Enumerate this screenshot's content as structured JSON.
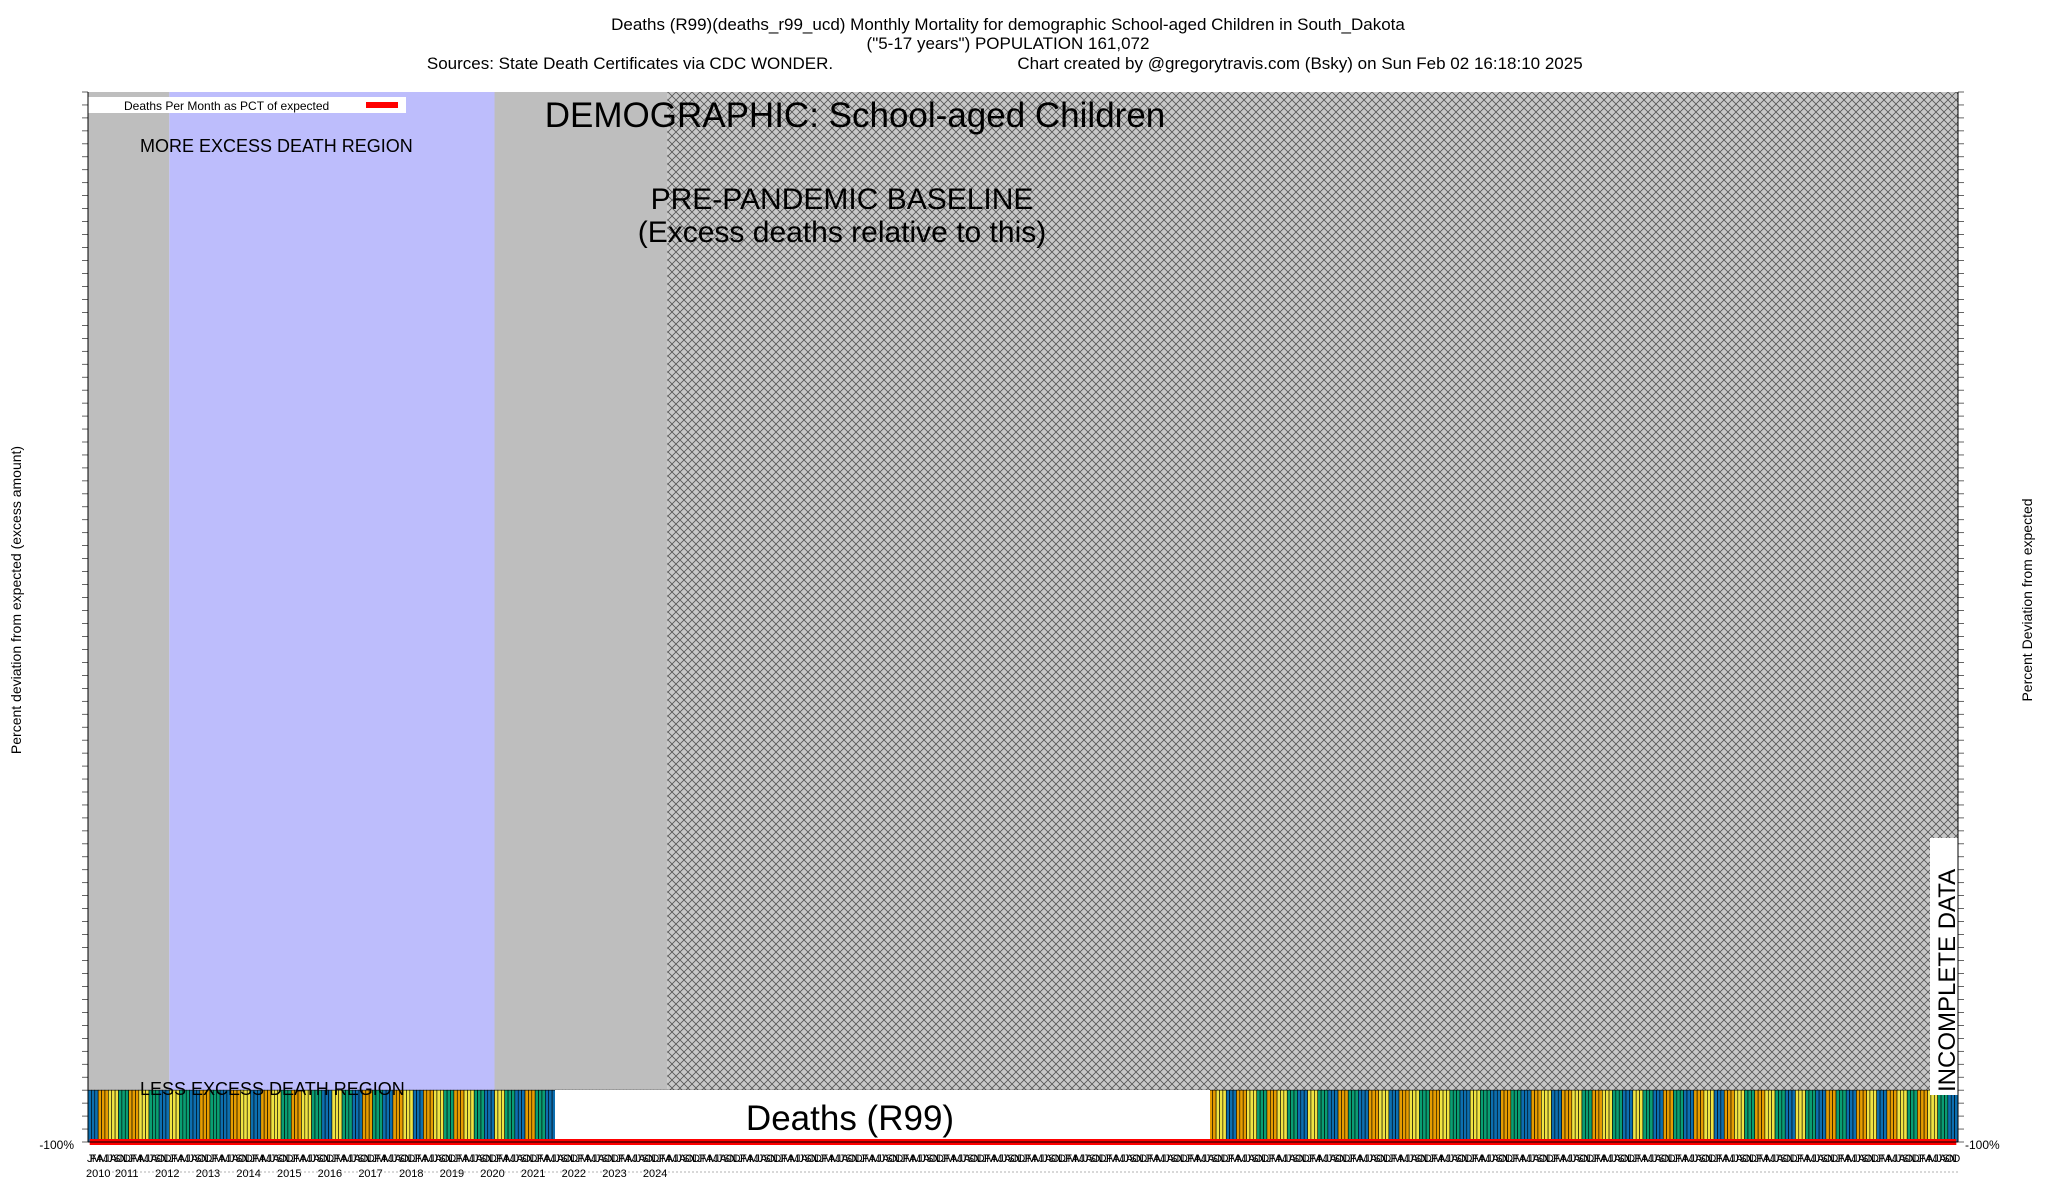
{
  "header": {
    "line1": "Deaths (R99)(deaths_r99_ucd) Monthly Mortality for demographic School-aged Children in South_Dakota",
    "line2": "(\"5-17 years\") POPULATION 161,072",
    "line3_left": "Sources: State Death Certificates via CDC WONDER.",
    "line3_right": "Chart created by @gregorytravis.com (Bsky) on Sun Feb 02 16:18:10 2025"
  },
  "legend": {
    "label": "Deaths Per Month as PCT of expected"
  },
  "annotations": {
    "demographic": "DEMOGRAPHIC: School-aged Children",
    "baseline_line1": "PRE-PANDEMIC BASELINE",
    "baseline_line2": "(Excess deaths relative to this)",
    "more_excess": "MORE EXCESS DEATH REGION",
    "less_excess": "LESS EXCESS DEATH REGION",
    "series_box": "Deaths (R99)",
    "incomplete": "INCOMPLETE DATA"
  },
  "axes": {
    "ylabel_left": "Percent deviation from expected (excess amount)",
    "ylabel_right": "Percent Deviation from expected",
    "bottom_tick": "-100%"
  },
  "colors": {
    "line": "#ff0000",
    "baseline_region": "#bdbdfc",
    "excess_region": "#bebebe",
    "bar_blue": "#0d6fb0",
    "bar_orange": "#e59c00",
    "bar_yellow": "#f0e442",
    "bar_green": "#0a9e73"
  },
  "chart_data": {
    "type": "bar",
    "title": "Deaths (R99)(deaths_r99_ucd) Monthly Mortality for demographic School-aged Children in South_Dakota",
    "ylabel": "Percent deviation from expected (excess amount)",
    "ylim": [
      -100,
      1925
    ],
    "start_year": 2010,
    "month_letters": [
      "J",
      "F",
      "M",
      "A",
      "M",
      "J",
      "J",
      "A",
      "S",
      "O",
      "N",
      "D"
    ],
    "years": [
      "2010",
      "2011",
      "2012",
      "2013",
      "2014",
      "2015",
      "2016",
      "2017",
      "2018",
      "2019",
      "2020",
      "2021",
      "2022",
      "2023",
      "2024"
    ],
    "baseline_years": [
      "2012",
      "2019"
    ],
    "incomplete_from": "2024-04",
    "series": [
      {
        "name": "Deaths Per Month as PCT of expected",
        "values": [
          -100,
          -100,
          -100,
          -100,
          -100,
          -100,
          -100,
          -100,
          -100,
          -100,
          -100,
          -100,
          -100,
          -100,
          -100,
          -100,
          -100,
          -100,
          -100,
          -100,
          -100,
          -100,
          -100,
          -100,
          -100,
          -100,
          -100,
          -100,
          -100,
          -100,
          -100,
          -100,
          -100,
          -100,
          -100,
          -100,
          -100,
          -100,
          -100,
          -100,
          -100,
          -100,
          -100,
          -100,
          -100,
          -100,
          -100,
          -100,
          -100,
          -100,
          -100,
          -100,
          -100,
          -100,
          -100,
          -100,
          -100,
          -100,
          -100,
          -100,
          -100,
          -100,
          -100,
          -100,
          -100,
          -100,
          -100,
          -100,
          -100,
          -100,
          -100,
          -100,
          -100,
          -100,
          -100,
          -100,
          -100,
          -100,
          -100,
          -100,
          -100,
          -100,
          -100,
          -100,
          -100,
          -100,
          -100,
          -100,
          -100,
          -100,
          -100,
          -100,
          -100,
          -100,
          -100,
          -100,
          -100,
          -100,
          -100,
          -100,
          -100,
          -100,
          -100,
          -100,
          -100,
          -100,
          -100,
          -100,
          -100,
          -100,
          -100,
          -100,
          -100,
          -100,
          -100,
          -100,
          -100,
          -100,
          -100,
          -100,
          -100,
          -100,
          -100,
          -100,
          -100,
          -100,
          -100,
          -100,
          -100,
          -100,
          -100,
          -100,
          -100,
          -100,
          -100,
          -100,
          -100,
          -100,
          -100,
          -100,
          -100,
          -100,
          -100,
          -100,
          -100,
          -100,
          -100,
          -100,
          -100,
          -100,
          -100,
          -100,
          -100,
          -100,
          -100,
          -100,
          -100,
          -100,
          -100,
          -100,
          -100,
          -100,
          -100,
          -100,
          -100,
          -100,
          -100,
          -100,
          -100,
          -100,
          -100,
          -100,
          -100,
          -100,
          -100,
          -100,
          -100,
          -100,
          -100,
          -100,
          -100,
          -100,
          -100,
          -100,
          -100,
          -100,
          -100,
          -100,
          -100,
          -100,
          -100,
          -100,
          -100,
          -100,
          -100,
          -100,
          -100,
          -100,
          -100,
          -100,
          -100,
          -100,
          -100,
          -100,
          -100,
          -100,
          -100,
          -100,
          -100,
          -100,
          -100,
          -100,
          -100,
          -100,
          -100,
          -100,
          -100,
          -100,
          -100,
          -100,
          -100,
          -100,
          -100,
          -100,
          -100,
          -100,
          -100,
          -100,
          -100,
          -100,
          -100,
          -100,
          -100,
          -100,
          -100,
          -100,
          -100,
          -100,
          -100,
          -100,
          -100,
          -100,
          -100,
          -100,
          -100,
          -100,
          -100,
          -100,
          -100,
          -100,
          -100,
          -100,
          -100,
          -100,
          -100,
          -100,
          -100,
          -100,
          -100,
          -100,
          -100,
          -100,
          -100,
          -100,
          -100,
          -100,
          -100,
          -100,
          -100,
          -100,
          -100,
          -100,
          -100,
          -100,
          -100,
          -100,
          -100,
          -100,
          -100,
          -100,
          -100,
          -100,
          -100,
          -100,
          -100,
          -100,
          -100,
          -100,
          -100,
          -100,
          -100,
          -100,
          -100,
          -100,
          -100,
          -100,
          -100,
          -100,
          -100,
          -100,
          -100,
          -100,
          -100,
          -100,
          -100,
          -100,
          -100,
          -100,
          -100,
          -100,
          -100,
          -100,
          -100,
          -100,
          -100,
          -100,
          -100,
          -100,
          -100,
          -100,
          -100,
          -100,
          -100,
          -100,
          -100,
          -100,
          -100,
          -100,
          -100,
          -100,
          -100,
          -100,
          -100,
          -100,
          -100,
          -100,
          -100,
          -100,
          -100,
          -100,
          -100,
          -100,
          -100,
          -100,
          -100,
          -100,
          -100,
          -100,
          -100,
          -100,
          -100,
          -100,
          -100,
          -100,
          -100,
          -100,
          -100,
          -100,
          -100,
          -100,
          -100,
          -100,
          -100,
          -100,
          -100,
          -100,
          -100,
          -100,
          -100,
          -100,
          -100,
          -100,
          -100,
          -100,
          -100,
          -100,
          -100,
          -100,
          -100,
          -100,
          -100,
          -100,
          -100,
          -100,
          -100,
          -100,
          -100,
          -100,
          -100,
          -100,
          -100,
          -100,
          -100,
          -100,
          -100,
          -100,
          -100,
          -100,
          -100,
          -100,
          -100,
          -100,
          -100,
          -100,
          -100,
          -100,
          -100,
          -100,
          -100,
          -100,
          -100,
          -100,
          -100,
          -100,
          -100,
          -100,
          -100,
          -100,
          -100,
          -100,
          -100,
          -100,
          -100,
          -100,
          -100,
          -100,
          -100,
          -100,
          -100,
          -100,
          -100,
          -100,
          -100,
          -100,
          -100,
          -100,
          -100,
          -100,
          -100,
          -100,
          -100,
          -100,
          -100,
          -100,
          -100,
          -100,
          -100,
          -100,
          -100,
          -100,
          -100,
          -100,
          -100,
          -100,
          -100,
          -100,
          -100,
          -100,
          -100,
          -100,
          -100,
          -100,
          -100,
          -100,
          -100,
          -100,
          -100,
          -100,
          -100,
          -100,
          -100,
          -100,
          -100,
          -100,
          -100,
          -100,
          -100,
          -100,
          -100,
          -100,
          -100,
          -100,
          -100,
          -100,
          -100,
          -100,
          -100,
          -100,
          -100,
          -100,
          -100,
          -100,
          -100,
          -100,
          -100,
          -100,
          -100,
          -100,
          -100,
          -100,
          -100,
          -100,
          -100,
          -100,
          -100,
          -100,
          -100,
          -100,
          -100,
          -100,
          -100,
          -100,
          -100,
          -100,
          -100,
          -100,
          -100,
          -100,
          -100,
          -100,
          -100,
          -100,
          -100,
          -100,
          -100,
          -100,
          -100,
          -100,
          -100,
          -100,
          -100,
          -100,
          -100,
          -100,
          -100,
          -100,
          -100,
          -100,
          -100,
          -100,
          -100,
          -100,
          -100,
          -100,
          -100,
          -100,
          -100,
          -100,
          -100,
          -100,
          -100,
          -100
        ]
      }
    ]
  }
}
